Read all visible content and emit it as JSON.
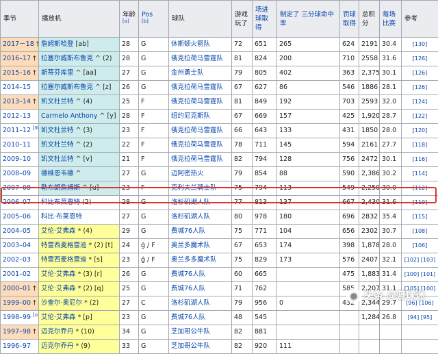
{
  "headers": {
    "season": "季节",
    "player": "播放机",
    "age": "年龄",
    "age_sup": "[a]",
    "pos": "Pos",
    "pos_sup": "[b]",
    "team": "球队",
    "gp": "游戏玩了",
    "fg": "场进球取得",
    "threes": "制定了 三分球命中率",
    "ft": "罚球取得",
    "pts": "总积分",
    "ppg": "每场比赛",
    "ref": "参考"
  },
  "rows": [
    {
      "season": "2017－18",
      "season_mark": "†",
      "season_sup": "",
      "player": "詹姆斯哈登",
      "player_mark": "",
      "player_sup": "[ab]",
      "age": "28",
      "pos": "G",
      "team": "休斯顿火箭队",
      "gp": "72",
      "fg": "651",
      "threes": "265",
      "ft": "624",
      "pts": "2191",
      "ppg": "30.4",
      "ref": "[130]",
      "season_color": "orange",
      "player_color": "cyan"
    },
    {
      "season": "2016–17",
      "season_mark": "†",
      "season_sup": "",
      "player": "拉塞尔威斯布鲁克",
      "player_mark": "^",
      "player_sup": "(2)",
      "age": "28",
      "pos": "G",
      "team": "俄克拉荷马雷霆队",
      "gp": "81",
      "fg": "824",
      "threes": "200",
      "ft": "710",
      "pts": "2558",
      "ppg": "31.6",
      "ref": "[126]",
      "season_color": "orange",
      "player_color": "cyan"
    },
    {
      "season": "2015–16",
      "season_mark": "†",
      "season_sup": "",
      "player": "斯蒂芬库里",
      "player_mark": "^",
      "player_sup": "[aa]",
      "age": "27",
      "pos": "G",
      "team": "金州勇士队",
      "gp": "79",
      "fg": "805",
      "threes": "402",
      "ft": "363",
      "pts": "2,375",
      "ppg": "30.1",
      "ref": "[126]",
      "season_color": "orange",
      "player_color": "cyan"
    },
    {
      "season": "2014–15",
      "season_mark": "",
      "season_sup": "",
      "player": "拉塞尔威斯布鲁克",
      "player_mark": "^",
      "player_sup": "[z]",
      "age": "26",
      "pos": "G",
      "team": "俄克拉荷马雷霆队",
      "gp": "67",
      "fg": "627",
      "threes": "86",
      "ft": "546",
      "pts": "1886",
      "ppg": "28.1",
      "ref": "[126]",
      "season_color": "",
      "player_color": "cyan"
    },
    {
      "season": "2013–14",
      "season_mark": "†",
      "season_sup": "",
      "player": "凯文杜兰特",
      "player_mark": "^",
      "player_sup": "(4)",
      "age": "25",
      "pos": "F",
      "team": "俄克拉荷马雷霆队",
      "gp": "81",
      "fg": "849",
      "threes": "192",
      "ft": "703",
      "pts": "2593",
      "ppg": "32.0",
      "ref": "[124]",
      "season_color": "orange",
      "player_color": "cyan"
    },
    {
      "season": "2012–13",
      "season_mark": "",
      "season_sup": "",
      "player": "Carmelo Anthony",
      "player_mark": "^",
      "player_sup": "[y]",
      "age": "28",
      "pos": "F",
      "team": "纽约尼克斯队",
      "gp": "67",
      "fg": "669",
      "threes": "157",
      "ft": "425",
      "pts": "1,920",
      "ppg": "28.7",
      "ref": "[122]",
      "season_color": "",
      "player_color": "cyan"
    },
    {
      "season": "2011–12",
      "season_mark": "",
      "season_sup": "[W]",
      "player": "凯文杜兰特",
      "player_mark": "^",
      "player_sup": "(3)",
      "age": "23",
      "pos": "F",
      "team": "俄克拉荷马雷霆队",
      "gp": "66",
      "fg": "643",
      "threes": "133",
      "ft": "431",
      "pts": "1850",
      "ppg": "28.0",
      "ref": "[120]",
      "season_color": "",
      "player_color": "cyan"
    },
    {
      "season": "2010–11",
      "season_mark": "",
      "season_sup": "",
      "player": "凯文杜兰特",
      "player_mark": "^",
      "player_sup": "(2)",
      "age": "22",
      "pos": "F",
      "team": "俄克拉荷马雷霆队",
      "gp": "78",
      "fg": "711",
      "threes": "145",
      "ft": "594",
      "pts": "2161",
      "ppg": "27.7",
      "ref": "[118]",
      "season_color": "",
      "player_color": "cyan"
    },
    {
      "season": "2009–10",
      "season_mark": "",
      "season_sup": "",
      "player": "凯文杜兰特",
      "player_mark": "^",
      "player_sup": "[v]",
      "age": "21",
      "pos": "F",
      "team": "俄克拉荷马雷霆队",
      "gp": "82",
      "fg": "794",
      "threes": "128",
      "ft": "756",
      "pts": "2472",
      "ppg": "30.1",
      "ref": "[116]",
      "season_color": "",
      "player_color": "cyan"
    },
    {
      "season": "2008–09",
      "season_mark": "",
      "season_sup": "",
      "player": "德维恩韦德",
      "player_mark": "^",
      "player_sup": "",
      "age": "27",
      "pos": "G",
      "team": "迈阿密热火",
      "gp": "79",
      "fg": "854",
      "threes": "88",
      "ft": "590",
      "pts": "2,386",
      "ppg": "30.2",
      "ref": "[114]",
      "season_color": "",
      "player_color": "cyan"
    },
    {
      "season": "2007–08",
      "season_mark": "",
      "season_sup": "",
      "player": "勒布朗詹姆斯",
      "player_mark": "^",
      "player_sup": "[u]",
      "age": "23",
      "pos": "F",
      "team": "克利夫兰骑士队",
      "gp": "75",
      "fg": "794",
      "threes": "113",
      "ft": "549",
      "pts": "2,250",
      "ppg": "30.0",
      "ref": "[112]",
      "season_color": "",
      "player_color": "cyan"
    },
    {
      "season": "2006–07",
      "season_mark": "",
      "season_sup": "",
      "player": "科比布莱恩特",
      "player_mark": "",
      "player_sup": "(2)",
      "age": "28",
      "pos": "G",
      "team": "洛杉矶湖人队",
      "gp": "77",
      "fg": "813",
      "threes": "137",
      "ft": "667",
      "pts": "2,430",
      "ppg": "31.6",
      "ref": "[110]",
      "season_color": "",
      "player_color": ""
    },
    {
      "season": "2005–06",
      "season_mark": "",
      "season_sup": "",
      "player": "科比·布莱恩特",
      "player_mark": "",
      "player_sup": "",
      "age": "27",
      "pos": "G",
      "team": "洛杉矶湖人队",
      "gp": "80",
      "fg": "978",
      "threes": "180",
      "ft": "696",
      "pts": "2832",
      "ppg": "35.4",
      "ref": "[115]",
      "season_color": "",
      "player_color": ""
    },
    {
      "season": "2004–05",
      "season_mark": "",
      "season_sup": "",
      "player": "艾伦·艾弗森",
      "player_mark": "*",
      "player_sup": "(4)",
      "age": "29",
      "pos": "G",
      "team": "费城76人队",
      "gp": "75",
      "fg": "771",
      "threes": "104",
      "ft": "656",
      "pts": "2302",
      "ppg": "30.7",
      "ref": "[108]",
      "season_color": "",
      "player_color": "yellow"
    },
    {
      "season": "2003–04",
      "season_mark": "",
      "season_sup": "",
      "player": "特雷西麦格雷迪",
      "player_mark": "*",
      "player_sup": "(2) [t]",
      "age": "24",
      "pos": "ģ / F",
      "team": "奥兰多魔术队",
      "gp": "67",
      "fg": "653",
      "threes": "174",
      "ft": "398",
      "pts": "1,878",
      "ppg": "28.0",
      "ref": "[106]",
      "season_color": "",
      "player_color": "yellow"
    },
    {
      "season": "2002–03",
      "season_mark": "",
      "season_sup": "",
      "player": "特雷西麦格雷迪",
      "player_mark": "*",
      "player_sup": "[s]",
      "age": "23",
      "pos": "ģ / F",
      "team": "奥兰多多魔术队",
      "gp": "75",
      "fg": "829",
      "threes": "173",
      "ft": "576",
      "pts": "2407",
      "ppg": "32.1",
      "ref": "[102] [103]",
      "season_color": "",
      "player_color": "yellow"
    },
    {
      "season": "2001–02",
      "season_mark": "",
      "season_sup": "",
      "player": "艾伦·艾弗森",
      "player_mark": "*",
      "player_sup": "(3) [r]",
      "age": "26",
      "pos": "G",
      "team": "费城76人队",
      "gp": "60",
      "fg": "665",
      "threes": "",
      "ft": "475",
      "pts": "1,883",
      "ppg": "31.4",
      "ref": "[100] [101]",
      "season_color": "",
      "player_color": "yellow"
    },
    {
      "season": "2000–01",
      "season_mark": "†",
      "season_sup": "",
      "player": "艾伦·艾弗森",
      "player_mark": "*",
      "player_sup": "(2) [q]",
      "age": "25",
      "pos": "G",
      "team": "费城76人队",
      "gp": "71",
      "fg": "762",
      "threes": "",
      "ft": "585",
      "pts": "2,207",
      "ppg": "31.1",
      "ref": "[105] [100]",
      "season_color": "orange",
      "player_color": "yellow"
    },
    {
      "season": "1999–00",
      "season_mark": "†",
      "season_sup": "",
      "player": "沙奎尔·奥尼尔",
      "player_mark": "*",
      "player_sup": "(2)",
      "age": "27",
      "pos": "C",
      "team": "洛杉矶湖人队",
      "gp": "79",
      "fg": "956",
      "threes": "0",
      "ft": "432",
      "pts": "2,344",
      "ppg": "29.7",
      "ref": "[96] [106]",
      "season_color": "orange",
      "player_color": "yellow"
    },
    {
      "season": "1998–99",
      "season_mark": "",
      "season_sup": "[o]",
      "player": "艾伦·艾弗森",
      "player_mark": "*",
      "player_sup": "[p]",
      "age": "23",
      "pos": "G",
      "team": "费城76人队",
      "gp": "48",
      "fg": "545",
      "threes": "",
      "ft": "",
      "pts": "1,284",
      "ppg": "26.8",
      "ref": "[94] [95]",
      "season_color": "",
      "player_color": "yellow"
    },
    {
      "season": "1997–98",
      "season_mark": "†",
      "season_sup": "",
      "player": "迈克尔乔丹",
      "player_mark": "*",
      "player_sup": "(10)",
      "age": "34",
      "pos": "G",
      "team": "芝加哥公牛队",
      "gp": "82",
      "fg": "881",
      "threes": "",
      "ft": "",
      "pts": "",
      "ppg": "",
      "ref": "",
      "season_color": "orange",
      "player_color": "yellow"
    },
    {
      "season": "1996–97",
      "season_mark": "",
      "season_sup": "",
      "player": "迈克尔乔丹",
      "player_mark": "*",
      "player_sup": "(9)",
      "age": "33",
      "pos": "G",
      "team": "芝加哥公牛队",
      "gp": "82",
      "fg": "920",
      "threes": "111",
      "ft": "",
      "pts": "",
      "ppg": "",
      "ref": "",
      "season_color": "",
      "player_color": "yellow"
    }
  ],
  "watermark": "头条 @篮球迷"
}
